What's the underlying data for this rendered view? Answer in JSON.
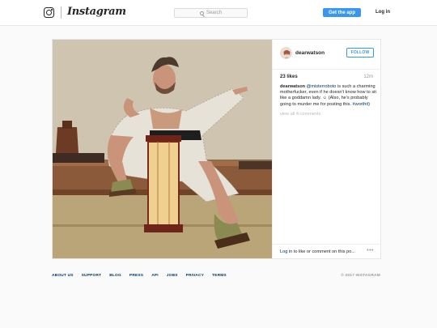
{
  "header": {
    "brand": "Instagram",
    "search_placeholder": "Search",
    "get_app_label": "Get the app",
    "login_label": "Log in"
  },
  "post": {
    "username": "dearwatson",
    "follow_label": "FOLLOW",
    "likes": "23 likes",
    "time_ago": "12m",
    "caption": {
      "author": "dearwatson",
      "mention": "@misterroboto",
      "text_part1": " is such a charming motherfucker, even if he doesn't know how to sit like a goddamn lady. ☺ (Also, he's probably going to murder me for posting this. ",
      "hashtag": "#worthit",
      "text_part2": ")"
    },
    "view_all_comments": "view all 4 comments",
    "login_link": "Log in",
    "login_prompt": " to like or comment on this po...",
    "more_icon": "ellipsis-icon"
  },
  "footer": {
    "links": [
      "ABOUT US",
      "SUPPORT",
      "BLOG",
      "PRESS",
      "API",
      "JOBS",
      "PRIVACY",
      "TERMS"
    ],
    "copyright": "© 2017 INSTAGRAM"
  },
  "colors": {
    "accent": "#3897f0",
    "link": "#003569",
    "muted": "#999999"
  }
}
